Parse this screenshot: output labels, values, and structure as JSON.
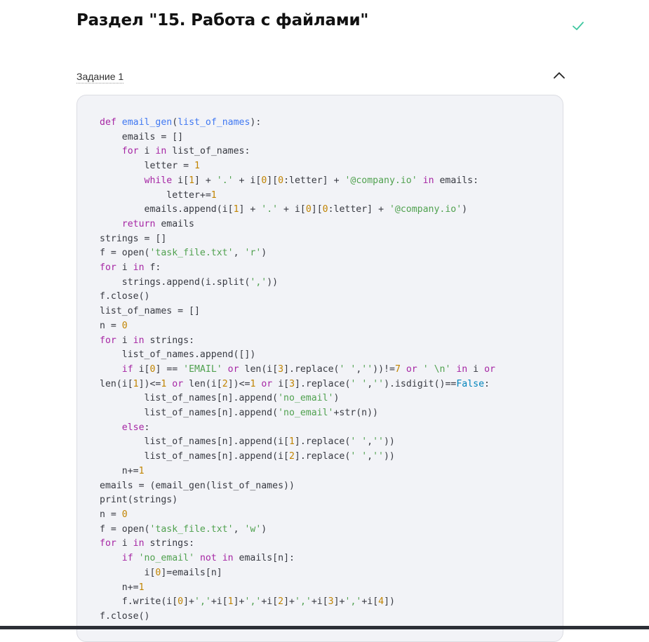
{
  "section": {
    "title": "Раздел \"15. Работа с файлами\"",
    "completed": true,
    "accent_color": "#3fc7a0"
  },
  "task": {
    "label": "Задание 1",
    "expanded": true,
    "toggle_icon": "chevron-up-icon"
  },
  "code": {
    "language": "python",
    "lines": [
      [
        [
          "kw",
          "def "
        ],
        [
          "fn",
          "email_gen"
        ],
        [
          "pl",
          "("
        ],
        [
          "fn",
          "list_of_names"
        ],
        [
          "pl",
          "):"
        ]
      ],
      [
        [
          "pl",
          "    emails = []"
        ]
      ],
      [
        [
          "pl",
          "    "
        ],
        [
          "kw",
          "for"
        ],
        [
          "pl",
          " i "
        ],
        [
          "kw",
          "in"
        ],
        [
          "pl",
          " list_of_names:"
        ]
      ],
      [
        [
          "pl",
          "        letter = "
        ],
        [
          "num",
          "1"
        ]
      ],
      [
        [
          "pl",
          "        "
        ],
        [
          "kw",
          "while"
        ],
        [
          "pl",
          " i["
        ],
        [
          "num",
          "1"
        ],
        [
          "pl",
          "] + "
        ],
        [
          "str",
          "'.'"
        ],
        [
          "pl",
          " + i["
        ],
        [
          "num",
          "0"
        ],
        [
          "pl",
          "]["
        ],
        [
          "num",
          "0"
        ],
        [
          "pl",
          ":letter] + "
        ],
        [
          "str",
          "'@company.io'"
        ],
        [
          "pl",
          " "
        ],
        [
          "kw",
          "in"
        ],
        [
          "pl",
          " emails:"
        ]
      ],
      [
        [
          "pl",
          "            letter+="
        ],
        [
          "num",
          "1"
        ]
      ],
      [
        [
          "pl",
          "        emails.append(i["
        ],
        [
          "num",
          "1"
        ],
        [
          "pl",
          "] + "
        ],
        [
          "str",
          "'.'"
        ],
        [
          "pl",
          " + i["
        ],
        [
          "num",
          "0"
        ],
        [
          "pl",
          "]["
        ],
        [
          "num",
          "0"
        ],
        [
          "pl",
          ":letter] + "
        ],
        [
          "str",
          "'@company.io'"
        ],
        [
          "pl",
          ")"
        ]
      ],
      [
        [
          "pl",
          "    "
        ],
        [
          "kw",
          "return"
        ],
        [
          "pl",
          " emails"
        ]
      ],
      [
        [
          "pl",
          "strings = []"
        ]
      ],
      [
        [
          "pl",
          "f = open("
        ],
        [
          "str",
          "'task_file.txt'"
        ],
        [
          "pl",
          ", "
        ],
        [
          "str",
          "'r'"
        ],
        [
          "pl",
          ")"
        ]
      ],
      [
        [
          "kw",
          "for"
        ],
        [
          "pl",
          " i "
        ],
        [
          "kw",
          "in"
        ],
        [
          "pl",
          " f:"
        ]
      ],
      [
        [
          "pl",
          "    strings.append(i.split("
        ],
        [
          "str",
          "','"
        ],
        [
          "pl",
          "))"
        ]
      ],
      [
        [
          "pl",
          "f.close()"
        ]
      ],
      [
        [
          "pl",
          "list_of_names = []"
        ]
      ],
      [
        [
          "pl",
          "n = "
        ],
        [
          "num",
          "0"
        ]
      ],
      [
        [
          "kw",
          "for"
        ],
        [
          "pl",
          " i "
        ],
        [
          "kw",
          "in"
        ],
        [
          "pl",
          " strings:"
        ]
      ],
      [
        [
          "pl",
          "    list_of_names.append([])"
        ]
      ],
      [
        [
          "pl",
          "    "
        ],
        [
          "kw",
          "if"
        ],
        [
          "pl",
          " i["
        ],
        [
          "num",
          "0"
        ],
        [
          "pl",
          "] == "
        ],
        [
          "str",
          "'EMAIL'"
        ],
        [
          "pl",
          " "
        ],
        [
          "kw",
          "or"
        ],
        [
          "pl",
          " len(i["
        ],
        [
          "num",
          "3"
        ],
        [
          "pl",
          "].replace("
        ],
        [
          "str",
          "' '"
        ],
        [
          "pl",
          ","
        ],
        [
          "str",
          "''"
        ],
        [
          "pl",
          "))!="
        ],
        [
          "num",
          "7"
        ],
        [
          "pl",
          " "
        ],
        [
          "kw",
          "or"
        ],
        [
          "pl",
          " "
        ],
        [
          "str",
          "' \\n'"
        ],
        [
          "pl",
          " "
        ],
        [
          "kw",
          "in"
        ],
        [
          "pl",
          " i "
        ],
        [
          "kw",
          "or"
        ]
      ],
      [
        [
          "pl",
          "len(i["
        ],
        [
          "num",
          "1"
        ],
        [
          "pl",
          "])<="
        ],
        [
          "num",
          "1"
        ],
        [
          "pl",
          " "
        ],
        [
          "kw",
          "or"
        ],
        [
          "pl",
          " len(i["
        ],
        [
          "num",
          "2"
        ],
        [
          "pl",
          "])<="
        ],
        [
          "num",
          "1"
        ],
        [
          "pl",
          " "
        ],
        [
          "kw",
          "or"
        ],
        [
          "pl",
          " i["
        ],
        [
          "num",
          "3"
        ],
        [
          "pl",
          "].replace("
        ],
        [
          "str",
          "' '"
        ],
        [
          "pl",
          ","
        ],
        [
          "str",
          "''"
        ],
        [
          "pl",
          ").isdigit()=="
        ],
        [
          "bi",
          "False"
        ],
        [
          "pl",
          ":"
        ]
      ],
      [
        [
          "pl",
          "        list_of_names[n].append("
        ],
        [
          "str",
          "'no_email'"
        ],
        [
          "pl",
          ")"
        ]
      ],
      [
        [
          "pl",
          "        list_of_names[n].append("
        ],
        [
          "str",
          "'no_email'"
        ],
        [
          "pl",
          "+str(n))"
        ]
      ],
      [
        [
          "pl",
          "    "
        ],
        [
          "kw",
          "else"
        ],
        [
          "pl",
          ":"
        ]
      ],
      [
        [
          "pl",
          "        list_of_names[n].append(i["
        ],
        [
          "num",
          "1"
        ],
        [
          "pl",
          "].replace("
        ],
        [
          "str",
          "' '"
        ],
        [
          "pl",
          ","
        ],
        [
          "str",
          "''"
        ],
        [
          "pl",
          "))"
        ]
      ],
      [
        [
          "pl",
          "        list_of_names[n].append(i["
        ],
        [
          "num",
          "2"
        ],
        [
          "pl",
          "].replace("
        ],
        [
          "str",
          "' '"
        ],
        [
          "pl",
          ","
        ],
        [
          "str",
          "''"
        ],
        [
          "pl",
          "))"
        ]
      ],
      [
        [
          "pl",
          "    n+="
        ],
        [
          "num",
          "1"
        ]
      ],
      [
        [
          "pl",
          "emails = (email_gen(list_of_names))"
        ]
      ],
      [
        [
          "pl",
          "print(strings)"
        ]
      ],
      [
        [
          "pl",
          "n = "
        ],
        [
          "num",
          "0"
        ]
      ],
      [
        [
          "pl",
          "f = open("
        ],
        [
          "str",
          "'task_file.txt'"
        ],
        [
          "pl",
          ", "
        ],
        [
          "str",
          "'w'"
        ],
        [
          "pl",
          ")"
        ]
      ],
      [
        [
          "kw",
          "for"
        ],
        [
          "pl",
          " i "
        ],
        [
          "kw",
          "in"
        ],
        [
          "pl",
          " strings:"
        ]
      ],
      [
        [
          "pl",
          "    "
        ],
        [
          "kw",
          "if"
        ],
        [
          "pl",
          " "
        ],
        [
          "str",
          "'no_email'"
        ],
        [
          "pl",
          " "
        ],
        [
          "kw",
          "not in"
        ],
        [
          "pl",
          " emails[n]:"
        ]
      ],
      [
        [
          "pl",
          "        i["
        ],
        [
          "num",
          "0"
        ],
        [
          "pl",
          "]=emails[n]"
        ]
      ],
      [
        [
          "pl",
          "    n+="
        ],
        [
          "num",
          "1"
        ]
      ],
      [
        [
          "pl",
          "    f.write(i["
        ],
        [
          "num",
          "0"
        ],
        [
          "pl",
          "]+"
        ],
        [
          "str",
          "','"
        ],
        [
          "pl",
          "+i["
        ],
        [
          "num",
          "1"
        ],
        [
          "pl",
          "]+"
        ],
        [
          "str",
          "','"
        ],
        [
          "pl",
          "+i["
        ],
        [
          "num",
          "2"
        ],
        [
          "pl",
          "]+"
        ],
        [
          "str",
          "','"
        ],
        [
          "pl",
          "+i["
        ],
        [
          "num",
          "3"
        ],
        [
          "pl",
          "]+"
        ],
        [
          "str",
          "','"
        ],
        [
          "pl",
          "+i["
        ],
        [
          "num",
          "4"
        ],
        [
          "pl",
          "])"
        ]
      ],
      [
        [
          "pl",
          "f.close()"
        ]
      ]
    ]
  }
}
